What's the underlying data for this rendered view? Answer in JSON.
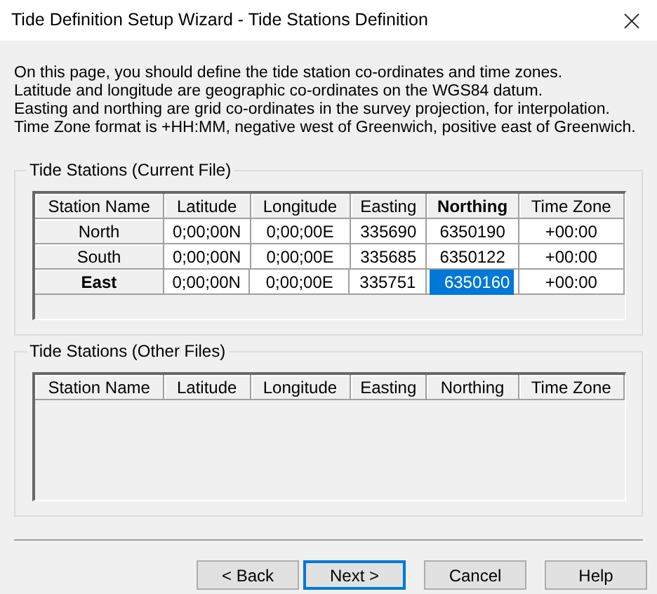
{
  "window": {
    "title": "Tide Definition Setup Wizard - Tide Stations Definition"
  },
  "intro": [
    "On this page, you should define the tide station co-ordinates and time zones.",
    "Latitude and longitude are geographic co-ordinates on the WGS84 datum.",
    "Easting and northing are grid co-ordinates in the survey projection, for interpolation.",
    "Time Zone format is +HH:MM, negative west of Greenwich, positive east of Greenwich."
  ],
  "current_file": {
    "title": "Tide Stations (Current File)",
    "columns": [
      {
        "label": "Station Name",
        "selected": false
      },
      {
        "label": "Latitude",
        "selected": false
      },
      {
        "label": "Longitude",
        "selected": false
      },
      {
        "label": "Easting",
        "selected": false
      },
      {
        "label": "Northing",
        "selected": true
      },
      {
        "label": "Time Zone",
        "selected": false
      }
    ],
    "rows": [
      {
        "selected": false,
        "cells": [
          {
            "text": "North",
            "selected": false
          },
          {
            "text": "0;00;00N",
            "selected": false
          },
          {
            "text": "0;00;00E",
            "selected": false
          },
          {
            "text": "335690",
            "selected": false
          },
          {
            "text": "6350190",
            "selected": false
          },
          {
            "text": "+00:00",
            "selected": false
          }
        ]
      },
      {
        "selected": false,
        "cells": [
          {
            "text": "South",
            "selected": false
          },
          {
            "text": "0;00;00N",
            "selected": false
          },
          {
            "text": "0;00;00E",
            "selected": false
          },
          {
            "text": "335685",
            "selected": false
          },
          {
            "text": "6350122",
            "selected": false
          },
          {
            "text": "+00:00",
            "selected": false
          }
        ]
      },
      {
        "selected": true,
        "cells": [
          {
            "text": "East",
            "selected": false
          },
          {
            "text": "0;00;00N",
            "selected": false
          },
          {
            "text": "0;00;00E",
            "selected": false
          },
          {
            "text": "335751",
            "selected": false
          },
          {
            "text": "6350160",
            "selected": true
          },
          {
            "text": "+00:00",
            "selected": false
          }
        ]
      }
    ]
  },
  "other_files": {
    "title": "Tide Stations (Other Files)",
    "columns": [
      {
        "label": "Station Name",
        "selected": false
      },
      {
        "label": "Latitude",
        "selected": false
      },
      {
        "label": "Longitude",
        "selected": false
      },
      {
        "label": "Easting",
        "selected": false
      },
      {
        "label": "Northing",
        "selected": false
      },
      {
        "label": "Time Zone",
        "selected": false
      }
    ]
  },
  "buttons": [
    {
      "label": "< Back",
      "default": false
    },
    {
      "label": "Next >",
      "default": true
    },
    {
      "label": "Cancel",
      "default": false
    },
    {
      "label": "Help",
      "default": false
    }
  ]
}
